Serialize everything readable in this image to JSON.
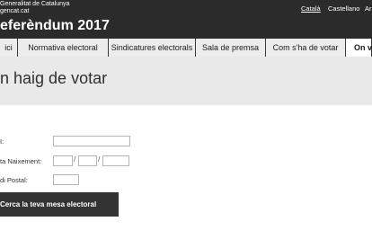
{
  "header": {
    "logo_line1": "Generalitat de Catalunya",
    "logo_line2": "gencat.cat",
    "site_title": "eferèndum 2017",
    "languages": [
      "Català",
      "Castellano",
      "Ar"
    ]
  },
  "nav": {
    "tabs": [
      "ici",
      "Normativa electoral",
      "Sindicatures electorals",
      "Sala de premsa",
      "Com s'ha de votar",
      "On vo"
    ]
  },
  "page": {
    "title": "n haig de votar"
  },
  "form": {
    "field1_label": "I:",
    "birthdate_label": "ta Naixement:",
    "separator": "/",
    "postal_label": "di Postal:",
    "submit_label": "Cerca la teva mesa electoral"
  }
}
